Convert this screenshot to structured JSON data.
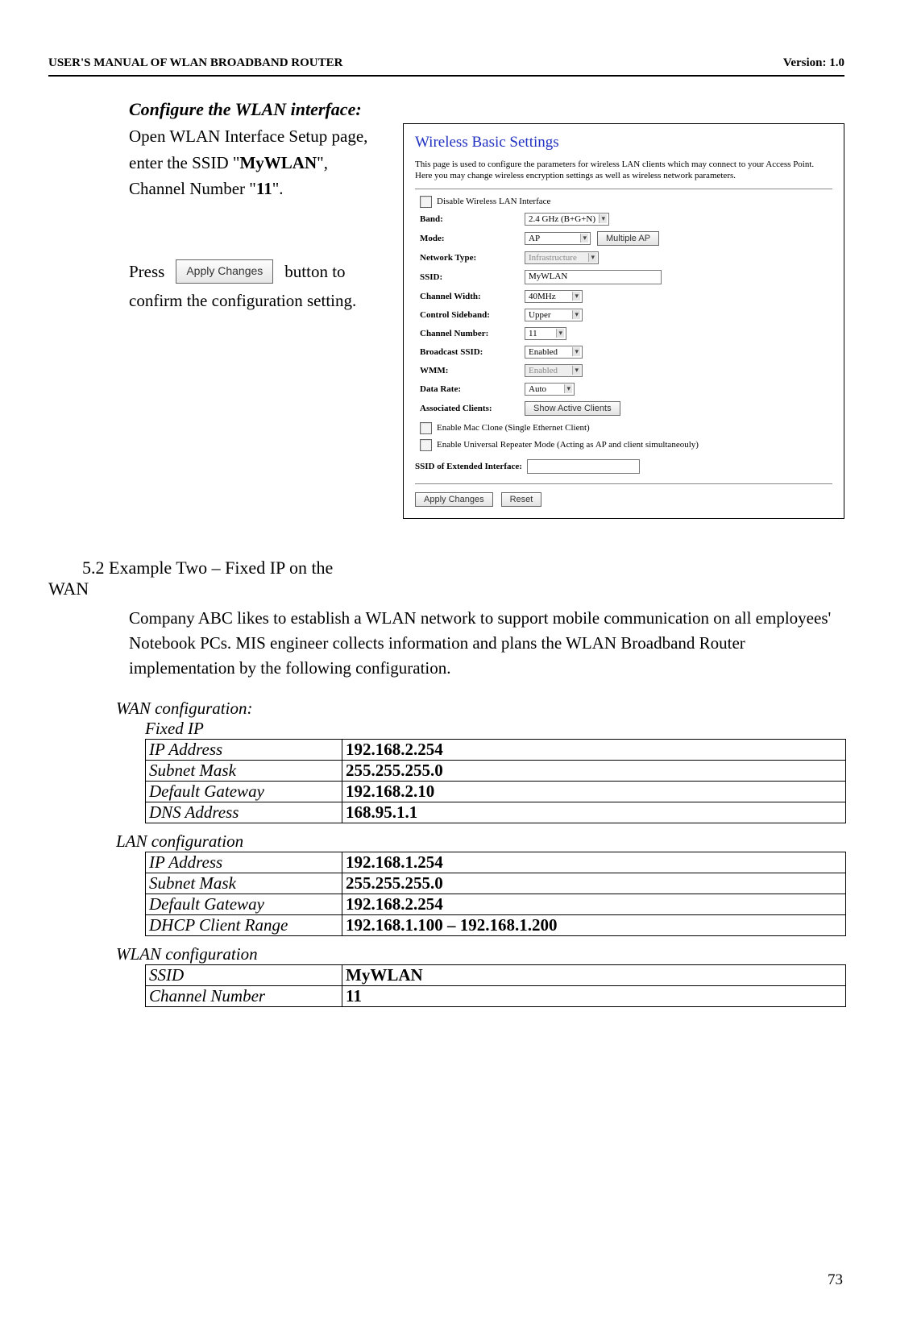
{
  "header": {
    "left": "USER'S MANUAL OF WLAN BROADBAND ROUTER",
    "right": "Version: 1.0"
  },
  "config_wlan": {
    "title": "Configure the WLAN interface:",
    "para1_a": "Open WLAN Interface Setup page, enter the SSID \"",
    "ssid_bold": "MyWLAN",
    "para1_b": "\", Channel Number \"",
    "chan_bold": "11",
    "para1_c": "\".",
    "press": "Press",
    "apply_btn": "Apply Changes",
    "press_after": "button to",
    "confirm": "confirm the configuration setting."
  },
  "panel": {
    "title": "Wireless Basic Settings",
    "desc": "This page is used to configure the parameters for wireless LAN clients which may connect to your Access Point. Here you may change wireless encryption settings as well as wireless network parameters.",
    "disable_label": "Disable Wireless LAN Interface",
    "rows": {
      "band_l": "Band:",
      "band_v": "2.4 GHz (B+G+N)",
      "mode_l": "Mode:",
      "mode_v": "AP",
      "mode_btn": "Multiple AP",
      "nt_l": "Network Type:",
      "nt_v": "Infrastructure",
      "ssid_l": "SSID:",
      "ssid_v": "MyWLAN",
      "cw_l": "Channel Width:",
      "cw_v": "40MHz",
      "cs_l": "Control Sideband:",
      "cs_v": "Upper",
      "cn_l": "Channel Number:",
      "cn_v": "11",
      "bs_l": "Broadcast SSID:",
      "bs_v": "Enabled",
      "wmm_l": "WMM:",
      "wmm_v": "Enabled",
      "dr_l": "Data Rate:",
      "dr_v": "Auto",
      "ac_l": "Associated Clients:",
      "ac_btn": "Show Active Clients",
      "mac_l": "Enable Mac Clone (Single Ethernet Client)",
      "rep_l": "Enable Universal Repeater Mode (Acting as AP and client simultaneouly)",
      "ext_l": "SSID of Extended Interface:",
      "apply": "Apply Changes",
      "reset": "Reset"
    }
  },
  "ex2": {
    "heading": "5.2 Example Two – Fixed IP on the",
    "heading2": "WAN",
    "body": "Company ABC likes to establish a WLAN network to support mobile communication on all employees' Notebook PCs. MIS engineer collects information and plans the WLAN Broadband Router implementation by the following configuration."
  },
  "wan": {
    "title": "WAN configuration:",
    "sub": "Fixed IP",
    "rows": [
      [
        "IP Address",
        "192.168.2.254"
      ],
      [
        "Subnet Mask",
        "255.255.255.0"
      ],
      [
        "Default Gateway",
        "192.168.2.10"
      ],
      [
        "DNS Address",
        "168.95.1.1"
      ]
    ]
  },
  "lan": {
    "title": "LAN configuration",
    "rows": [
      [
        "IP Address",
        "192.168.1.254"
      ],
      [
        "Subnet Mask",
        "255.255.255.0"
      ],
      [
        "Default Gateway",
        "192.168.2.254"
      ],
      [
        "DHCP Client Range",
        "192.168.1.100 – 192.168.1.200"
      ]
    ]
  },
  "wlan": {
    "title": "WLAN configuration",
    "rows": [
      [
        "SSID",
        "MyWLAN"
      ],
      [
        "Channel Number",
        "11"
      ]
    ]
  },
  "page_num": "73"
}
